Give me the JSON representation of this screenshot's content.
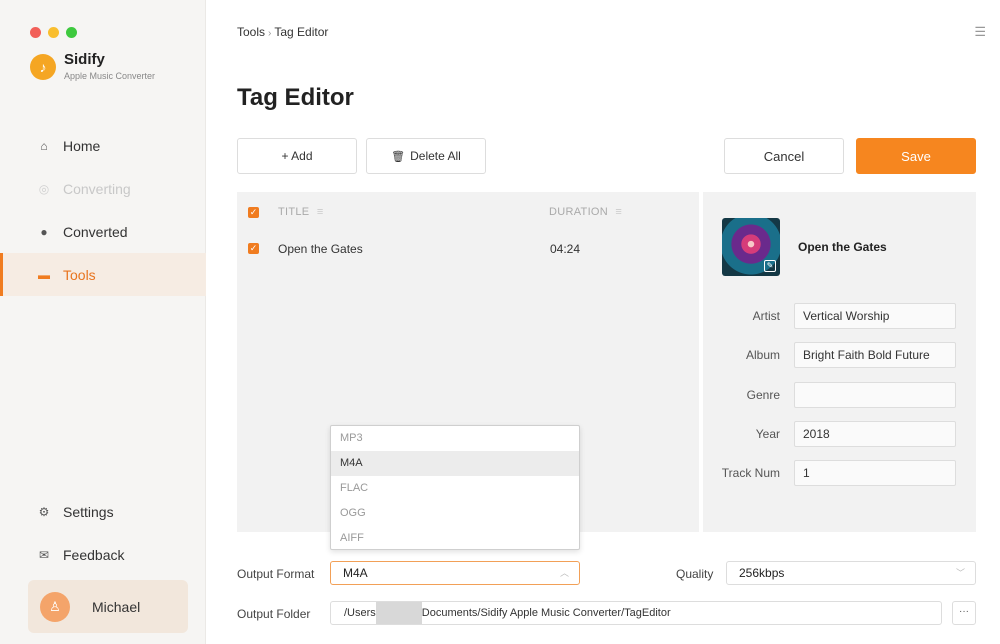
{
  "app": {
    "name": "Sidify",
    "subtitle": "Apple Music Converter",
    "logo_icon": "music-note-icon"
  },
  "sidebar": {
    "items": [
      {
        "label": "Home",
        "icon": "home-icon",
        "state": "normal"
      },
      {
        "label": "Converting",
        "icon": "converting-icon",
        "state": "disabled"
      },
      {
        "label": "Converted",
        "icon": "clock-icon",
        "state": "normal"
      },
      {
        "label": "Tools",
        "icon": "toolbox-icon",
        "state": "active"
      }
    ],
    "bottom_items": [
      {
        "label": "Settings",
        "icon": "gear-icon"
      },
      {
        "label": "Feedback",
        "icon": "mail-icon"
      }
    ],
    "user": {
      "name": "Michael",
      "avatar_icon": "user-icon"
    }
  },
  "breadcrumb": {
    "parent": "Tools",
    "separator": "›",
    "current": "Tag Editor"
  },
  "page_title": "Tag Editor",
  "toolbar": {
    "add_label": "+ Add",
    "delete_all_label": "Delete All",
    "cancel_label": "Cancel",
    "save_label": "Save"
  },
  "track_list": {
    "columns": {
      "title": "TITLE",
      "duration": "DURATION"
    },
    "rows": [
      {
        "title": "Open the Gates",
        "duration": "04:24",
        "checked": true
      }
    ]
  },
  "details": {
    "title": "Open the Gates",
    "artist_label": "Artist",
    "artist": "Vertical Worship",
    "album_label": "Album",
    "album": "Bright Faith Bold Future",
    "genre_label": "Genre",
    "genre": "",
    "year_label": "Year",
    "year": "2018",
    "track_label": "Track Num",
    "track": "1"
  },
  "output": {
    "format_label": "Output Format",
    "format_value": "M4A",
    "format_options": [
      "MP3",
      "M4A",
      "FLAC",
      "OGG",
      "AIFF"
    ],
    "quality_label": "Quality",
    "quality_value": "256kbps",
    "folder_label": "Output Folder",
    "folder_prefix": "/Users",
    "folder_suffix": "Documents/Sidify Apple Music Converter/TagEditor",
    "more_label": "···"
  },
  "colors": {
    "accent": "#f6861f",
    "active_bg": "#f6ece3",
    "panel": "#f2f2f2"
  }
}
